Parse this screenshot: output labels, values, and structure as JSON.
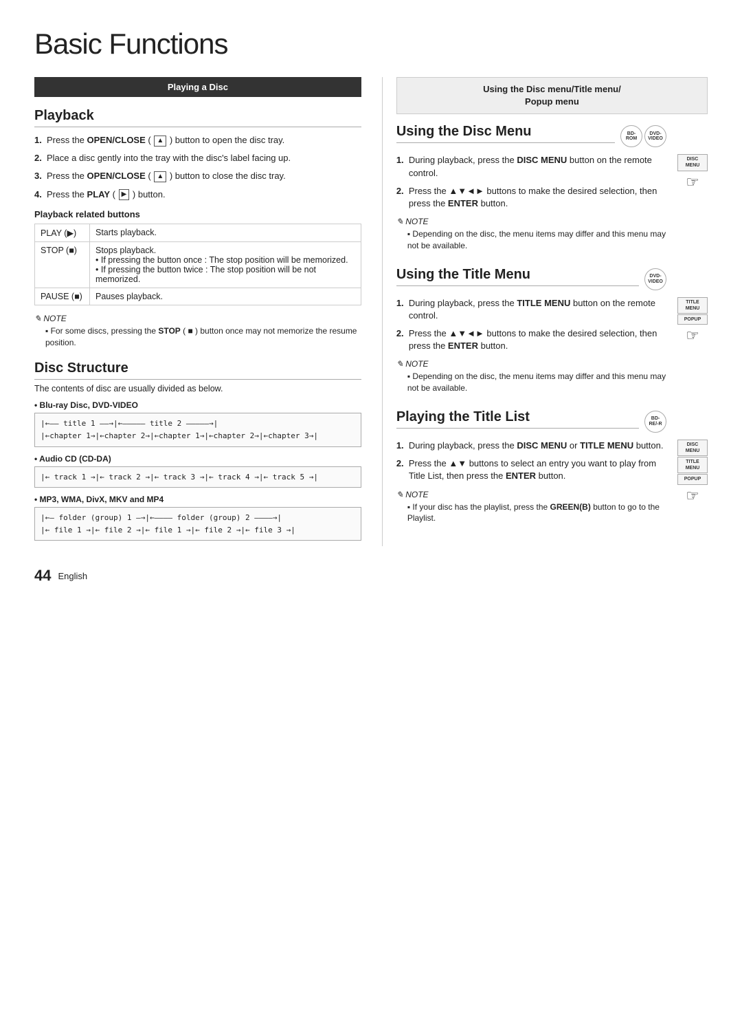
{
  "page": {
    "title": "Basic Functions",
    "page_number": "44",
    "language": "English"
  },
  "left_column": {
    "section_bar": "Playing a Disc",
    "playback": {
      "title": "Playback",
      "steps": [
        {
          "num": "1.",
          "text": "Press the <b>OPEN/CLOSE</b> ( <span class='icon-inline'>▲</span> ) button to open the disc tray."
        },
        {
          "num": "2.",
          "text": "Place a disc gently into the tray with the disc's label facing up."
        },
        {
          "num": "3.",
          "text": "Press the <b>OPEN/CLOSE</b> ( <span class='icon-inline'>▲</span> ) button to close the disc tray."
        },
        {
          "num": "4.",
          "text": "Press the <b>PLAY</b> ( <span class='icon-inline'>▶</span> ) button."
        }
      ],
      "related_buttons_heading": "Playback related buttons",
      "table_rows": [
        {
          "button": "PLAY (▶)",
          "description": "Starts playback."
        },
        {
          "button": "STOP (■)",
          "description": "Stops playback.\n• If pressing the button once : The stop position will be memorized.\n• If pressing the button twice : The stop position will be not memorized."
        },
        {
          "button": "PAUSE (■)",
          "description": "Pauses playback."
        }
      ],
      "note_label": "NOTE",
      "note_items": [
        "For some discs, pressing the <b>STOP</b> ( ■ ) button once may not memorize the resume position."
      ]
    },
    "disc_structure": {
      "title": "Disc Structure",
      "description": "The contents of disc are usually divided as below.",
      "items": [
        {
          "label": "Blu-ray Disc, DVD-VIDEO",
          "diagram_lines": [
            "|←—— title 1 ——→|←—————— title 2 ——————→|",
            "|←chapter 1→|←chapter 2→|←chapter 1→|←chapter 2→|←chapter 3→|"
          ]
        },
        {
          "label": "Audio CD (CD-DA)",
          "diagram_lines": [
            "|← track 1 →|← track 2 →|← track 3 →|← track 4 →|← track 5 →|"
          ]
        },
        {
          "label": "MP3, WMA, DivX, MKV and MP4",
          "diagram_lines": [
            "|←— folder (group) 1 —→|←———— folder (group) 2 ————→|",
            "|← file 1 →|← file 2 →|← file 1 →|← file 2 →|← file 3 →|"
          ]
        }
      ]
    }
  },
  "right_column": {
    "section_bar_line1": "Using the Disc menu/Title menu/",
    "section_bar_line2": "Popup menu",
    "disc_menu": {
      "title": "Using the Disc Menu",
      "badges": [
        "BD-ROM",
        "DVD-VIDEO"
      ],
      "side_badges": [
        "DISC MENU"
      ],
      "steps": [
        {
          "num": "1.",
          "text": "During playback, press the <b>DISC MENU</b> button on the remote control."
        },
        {
          "num": "2.",
          "text": "Press the ▲▼◄► buttons to make the desired selection, then press the <b>ENTER</b> button."
        }
      ],
      "note_label": "NOTE",
      "note_items": [
        "Depending on the disc, the menu items may differ and this menu may not be available."
      ]
    },
    "title_menu": {
      "title": "Using the Title Menu",
      "badges": [
        "DVD-VIDEO"
      ],
      "side_badges": [
        "TITLE MENU",
        "POPUP"
      ],
      "steps": [
        {
          "num": "1.",
          "text": "During playback, press the <b>TITLE MENU</b> button on the remote control."
        },
        {
          "num": "2.",
          "text": "Press the ▲▼◄► buttons to make the desired selection, then press the <b>ENTER</b> button."
        }
      ],
      "note_label": "NOTE",
      "note_items": [
        "Depending on the disc, the menu items may differ and this menu may not be available."
      ]
    },
    "title_list": {
      "title": "Playing the Title List",
      "badges": [
        "BD-RE/-R"
      ],
      "side_badges": [
        "DISC MENU",
        "TITLE MENU",
        "POPUP"
      ],
      "steps": [
        {
          "num": "1.",
          "text": "During playback, press the <b>DISC MENU</b> or <b>TITLE MENU</b> button."
        },
        {
          "num": "2.",
          "text": "Press the ▲▼ buttons to select an entry you want to play from Title List, then press the <b>ENTER</b> button."
        }
      ],
      "note_label": "NOTE",
      "note_items": [
        "If your disc has the playlist, press the <b>GREEN(B)</b> button to go to the Playlist."
      ]
    }
  }
}
